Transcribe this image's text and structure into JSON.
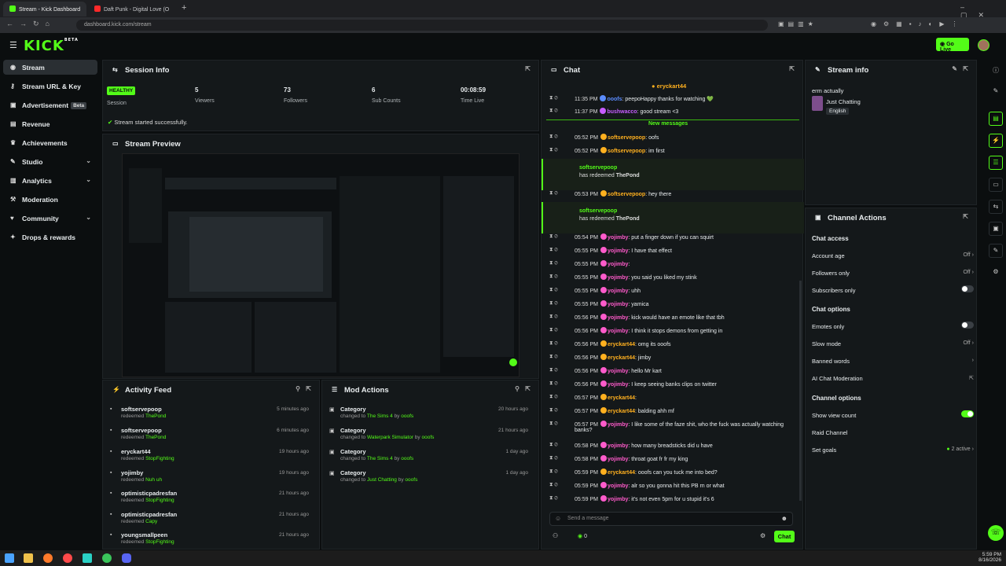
{
  "browser": {
    "tabs": [
      {
        "title": "Stream - Kick Dashboard"
      },
      {
        "title": "Daft Punk - Digital Love (O"
      }
    ],
    "url": "dashboard.kick.com/stream"
  },
  "brand": {
    "logo": "KICK",
    "beta": "BETA",
    "accent": "#53fc18",
    "go_live": "Go Live"
  },
  "sidebar": {
    "items": [
      {
        "label": "Stream",
        "icon": "radio-icon"
      },
      {
        "label": "Stream URL & Key",
        "icon": "key-icon"
      },
      {
        "label": "Advertisement",
        "icon": "ad-icon",
        "badge": "Beta"
      },
      {
        "label": "Revenue",
        "icon": "revenue-icon"
      },
      {
        "label": "Achievements",
        "icon": "trophy-icon"
      },
      {
        "label": "Studio",
        "icon": "studio-icon"
      },
      {
        "label": "Analytics",
        "icon": "chart-icon"
      },
      {
        "label": "Moderation",
        "icon": "hammer-icon"
      },
      {
        "label": "Community",
        "icon": "community-icon"
      },
      {
        "label": "Drops & rewards",
        "icon": "gift-icon"
      }
    ]
  },
  "session": {
    "title": "Session Info",
    "status": "HEALTHY",
    "status_label": "Session",
    "viewers": "5",
    "viewers_label": "Viewers",
    "followers": "73",
    "followers_label": "Followers",
    "subs": "6",
    "subs_label": "Sub Counts",
    "time": "00:08:59",
    "time_label": "Time Live",
    "message": "Stream started successfully."
  },
  "preview": {
    "title": "Stream Preview"
  },
  "activity": {
    "title": "Activity Feed",
    "rows": [
      {
        "name": "softservepoop",
        "action": "redeemed",
        "reward": "ThePond",
        "time": "5 minutes ago"
      },
      {
        "name": "softservepoop",
        "action": "redeemed",
        "reward": "ThePond",
        "time": "6 minutes ago"
      },
      {
        "name": "eryckart44",
        "action": "redeemed",
        "reward": "StopFighting",
        "time": "19 hours ago"
      },
      {
        "name": "yojimby",
        "action": "redeemed",
        "reward": "Nuh uh",
        "time": "19 hours ago"
      },
      {
        "name": "optimisticpadresfan",
        "action": "redeemed",
        "reward": "StopFighting",
        "time": "21 hours ago"
      },
      {
        "name": "optimisticpadresfan",
        "action": "redeemed",
        "reward": "Capy",
        "time": "21 hours ago"
      },
      {
        "name": "youngsmallpeen",
        "action": "redeemed",
        "reward": "StopFighting",
        "time": "21 hours ago"
      }
    ]
  },
  "modactions": {
    "title": "Mod Actions",
    "rows": [
      {
        "name": "Category",
        "pre": "changed to",
        "target": "The Sims 4",
        "by": "by",
        "who": "ooofs",
        "time": "20 hours ago"
      },
      {
        "name": "Category",
        "pre": "changed to",
        "target": "Waterpark Simulator",
        "by": "by",
        "who": "ooofs",
        "time": "21 hours ago"
      },
      {
        "name": "Category",
        "pre": "changed to",
        "target": "The Sims 4",
        "by": "by",
        "who": "ooofs",
        "time": "1 day ago"
      },
      {
        "name": "Category",
        "pre": "changed to",
        "target": "Just Chatting",
        "by": "by",
        "who": "ooofs",
        "time": "1 day ago"
      }
    ]
  },
  "chat": {
    "title": "Chat",
    "pinned": "eryckart44",
    "new_messages": "New messages",
    "placeholder": "Send a message",
    "send": "Chat",
    "count": "0",
    "messages": [
      {
        "time": "11:35 PM",
        "user": "ooofs",
        "color": "#5b8cff",
        "text": "peepoHappy thanks for watching 💚"
      },
      {
        "time": "11:37 PM",
        "user": "bushwacco",
        "color": "#c65cff",
        "text": "good stream <3"
      },
      {
        "time": "05:52 PM",
        "user": "softservepoop",
        "color": "#ffb01f",
        "text": "oofs"
      },
      {
        "time": "05:52 PM",
        "user": "softservepoop",
        "color": "#ffb01f",
        "text": "im first"
      },
      {
        "time": "05:53 PM",
        "user": "softservepoop",
        "color": "#ffb01f",
        "text": "hey there"
      },
      {
        "time": "05:54 PM",
        "user": "yojimby",
        "color": "#ff5bcb",
        "text": "put a finger down if you can squirt"
      },
      {
        "time": "05:55 PM",
        "user": "yojimby",
        "color": "#ff5bcb",
        "text": "I have that effect"
      },
      {
        "time": "05:55 PM",
        "user": "yojimby",
        "color": "#ff5bcb",
        "text": ""
      },
      {
        "time": "05:55 PM",
        "user": "yojimby",
        "color": "#ff5bcb",
        "text": "you said you liked my stink"
      },
      {
        "time": "05:55 PM",
        "user": "yojimby",
        "color": "#ff5bcb",
        "text": "uhh"
      },
      {
        "time": "05:55 PM",
        "user": "yojimby",
        "color": "#ff5bcb",
        "text": "yamica"
      },
      {
        "time": "05:56 PM",
        "user": "yojimby",
        "color": "#ff5bcb",
        "text": "kick would have an emote like that tbh"
      },
      {
        "time": "05:56 PM",
        "user": "yojimby",
        "color": "#ff5bcb",
        "text": "I think it stops demons from getting in"
      },
      {
        "time": "05:56 PM",
        "user": "eryckart44",
        "color": "#ffb01f",
        "text": "omg its ooofs"
      },
      {
        "time": "05:56 PM",
        "user": "eryckart44",
        "color": "#ffb01f",
        "text": "jimby"
      },
      {
        "time": "05:56 PM",
        "user": "yojimby",
        "color": "#ff5bcb",
        "text": "hello Mr kart"
      },
      {
        "time": "05:56 PM",
        "user": "yojimby",
        "color": "#ff5bcb",
        "text": "I keep seeing banks clips on twitter"
      },
      {
        "time": "05:57 PM",
        "user": "eryckart44",
        "color": "#ffb01f",
        "text": ""
      },
      {
        "time": "05:57 PM",
        "user": "eryckart44",
        "color": "#ffb01f",
        "text": "balding ahh mf"
      },
      {
        "time": "05:57 PM",
        "user": "yojimby",
        "color": "#ff5bcb",
        "text": "I like some of the faze shit, who the fuck was actually watching banks?"
      },
      {
        "time": "05:58 PM",
        "user": "yojimby",
        "color": "#ff5bcb",
        "text": "how many breadsticks did u have"
      },
      {
        "time": "05:58 PM",
        "user": "yojimby",
        "color": "#ff5bcb",
        "text": "throat goat fr fr my king"
      },
      {
        "time": "05:59 PM",
        "user": "eryckart44",
        "color": "#ffb01f",
        "text": "ooofs can you tuck me into bed?"
      },
      {
        "time": "05:59 PM",
        "user": "yojimby",
        "color": "#ff5bcb",
        "text": "alr so you gonna hit this PB rn or what"
      },
      {
        "time": "05:59 PM",
        "user": "yojimby",
        "color": "#ff5bcb",
        "text": "it's not even 5pm for u stupid it's 6"
      }
    ],
    "redeems": [
      {
        "user": "softservepoop",
        "text": "has redeemed",
        "reward": "ThePond"
      },
      {
        "user": "softservepoop",
        "text": "has redeemed",
        "reward": "ThePond"
      }
    ]
  },
  "streaminfo": {
    "title": "Stream info",
    "stream_title": "erm actually",
    "category": "Just Chatting",
    "language": "English"
  },
  "channelactions": {
    "title": "Channel Actions",
    "access": "Chat access",
    "account_age": "Account age",
    "account_age_val": "Off",
    "followers_only": "Followers only",
    "followers_only_val": "Off",
    "subs_only": "Subscribers only",
    "options": "Chat options",
    "emotes_only": "Emotes only",
    "slow": "Slow mode",
    "slow_val": "Off",
    "banned": "Banned words",
    "ai": "AI Chat Moderation",
    "chan_options": "Channel options",
    "show_view": "Show view count",
    "raid": "Raid Channel",
    "goals": "Set goals",
    "goals_val": "2 active"
  },
  "taskbar": {
    "time": "5:59 PM",
    "date": "8/16/2026"
  }
}
